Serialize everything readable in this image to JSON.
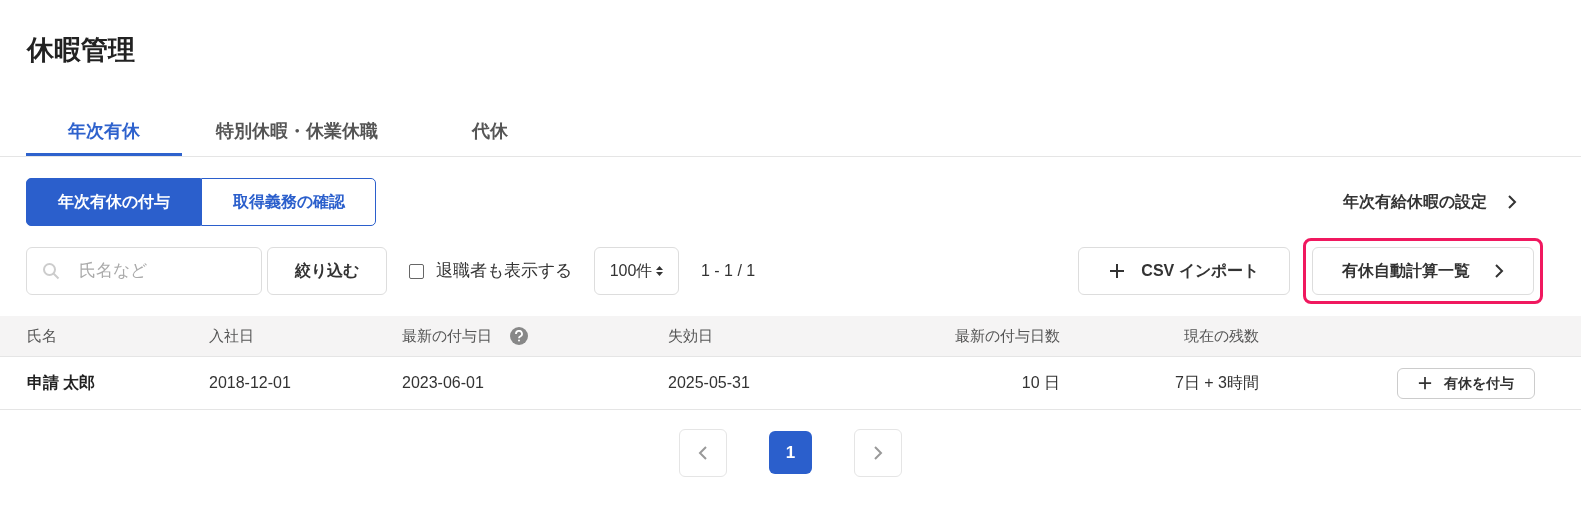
{
  "page_title": "休暇管理",
  "tabs": [
    {
      "label": "年次有休",
      "selected": true
    },
    {
      "label": "特別休暇・休業休職",
      "selected": false
    },
    {
      "label": "代休",
      "selected": false
    }
  ],
  "segments": [
    {
      "label": "年次有休の付与",
      "selected": true
    },
    {
      "label": "取得義務の確認",
      "selected": false
    }
  ],
  "settings_link": "年次有給休暇の設定",
  "search": {
    "placeholder": "氏名など"
  },
  "filter_button": "絞り込む",
  "show_retired": {
    "label": "退職者も表示する",
    "checked": false
  },
  "page_size": "100件",
  "range": "1 - 1 / 1",
  "import_button": "CSV インポート",
  "auto_calc_button": {
    "label": "有休自動計算一覧",
    "highlighted": true
  },
  "table": {
    "columns": [
      {
        "label": "氏名",
        "help": false
      },
      {
        "label": "入社日",
        "help": false
      },
      {
        "label": "最新の付与日",
        "help": true
      },
      {
        "label": "失効日",
        "help": false
      },
      {
        "label": "最新の付与日数",
        "help": false
      },
      {
        "label": "現在の残数",
        "help": false
      }
    ],
    "rows": [
      {
        "name": "申請 太郎",
        "joined": "2018-12-01",
        "granted": "2023-06-01",
        "expires": "2025-05-31",
        "days": "10 日",
        "remaining": "7日 + 3時間",
        "action": "有休を付与"
      }
    ]
  },
  "pagination": {
    "pages": [
      {
        "label": "1",
        "selected": true
      }
    ]
  }
}
